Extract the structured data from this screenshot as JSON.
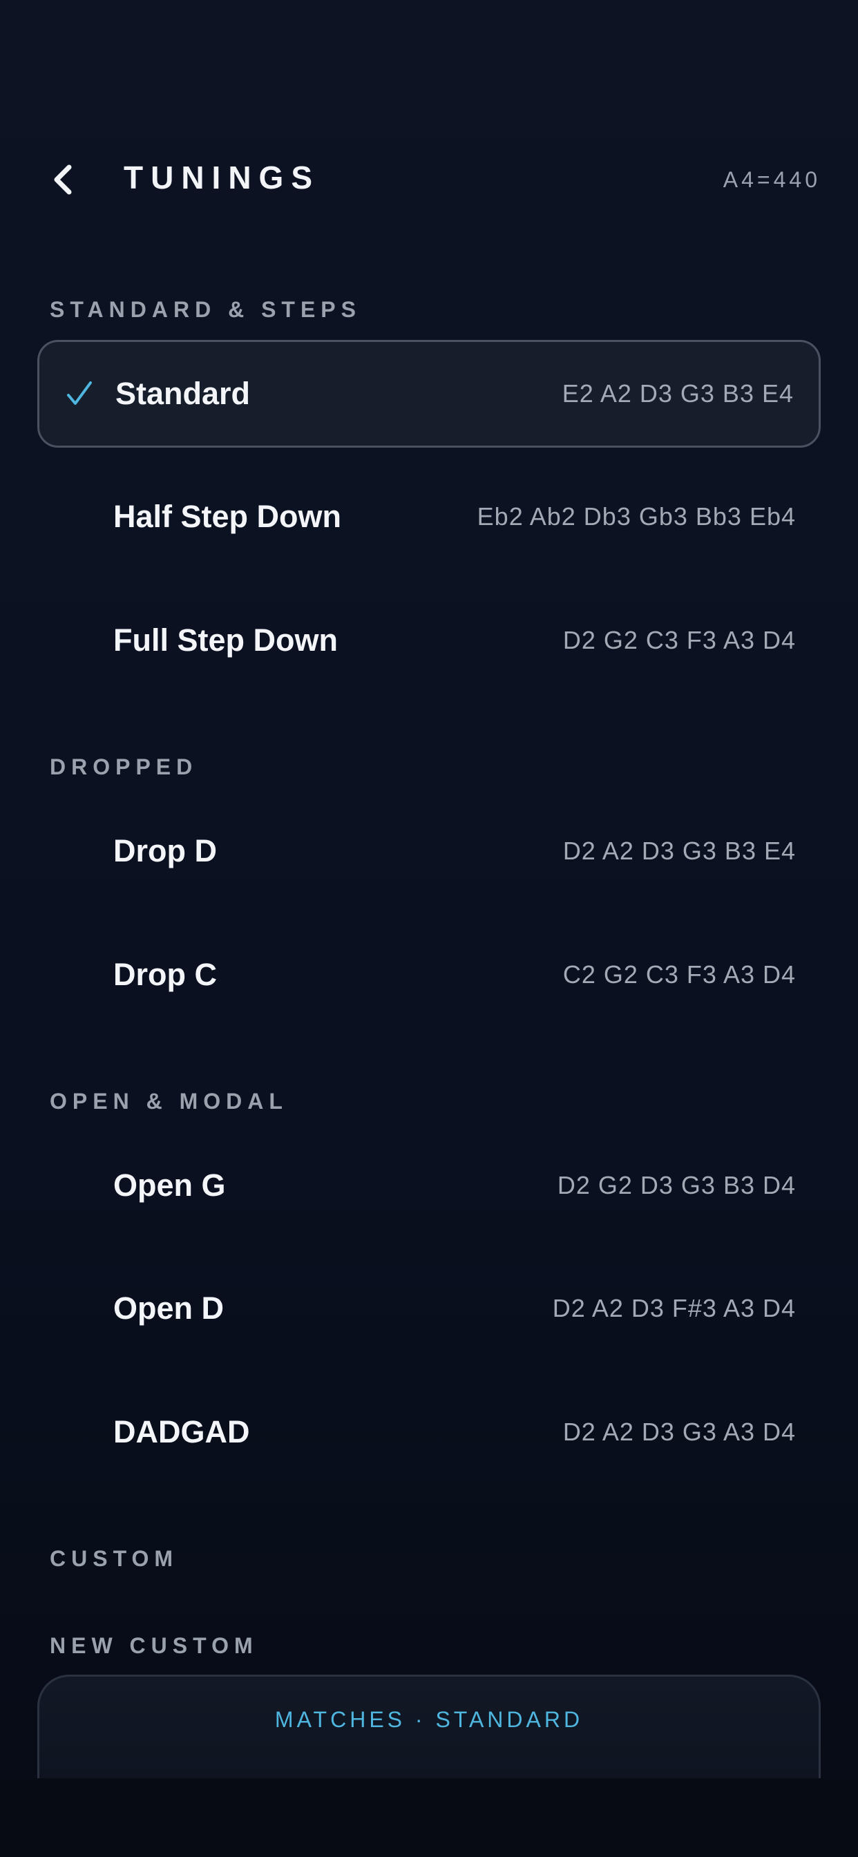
{
  "header": {
    "title": "TUNINGS",
    "reference": "A4=440",
    "back_icon": "chevron-left-icon"
  },
  "sections": [
    {
      "label": "STANDARD & STEPS",
      "items": [
        {
          "name": "Standard",
          "notes": "E2 A2 D3 G3 B3 E4",
          "selected": true
        },
        {
          "name": "Half Step Down",
          "notes": "Eb2 Ab2 Db3 Gb3 Bb3 Eb4",
          "selected": false
        },
        {
          "name": "Full Step Down",
          "notes": "D2 G2 C3 F3 A3 D4",
          "selected": false
        }
      ]
    },
    {
      "label": "DROPPED",
      "items": [
        {
          "name": "Drop D",
          "notes": "D2 A2 D3 G3 B3 E4",
          "selected": false
        },
        {
          "name": "Drop C",
          "notes": "C2 G2 C3 F3 A3 D4",
          "selected": false
        }
      ]
    },
    {
      "label": "OPEN & MODAL",
      "items": [
        {
          "name": "Open G",
          "notes": "D2 G2 D3 G3 B3 D4",
          "selected": false
        },
        {
          "name": "Open D",
          "notes": "D2 A2 D3 F#3 A3 D4",
          "selected": false
        },
        {
          "name": "DADGAD",
          "notes": "D2 A2 D3 G3 A3 D4",
          "selected": false
        }
      ]
    },
    {
      "label": "CUSTOM",
      "items": []
    }
  ],
  "new_custom": {
    "label": "NEW CUSTOM",
    "match_text": "MATCHES · STANDARD"
  },
  "colors": {
    "accent": "#4fb6e0",
    "background": "#0a1020",
    "selected_row": "#161d2b"
  }
}
